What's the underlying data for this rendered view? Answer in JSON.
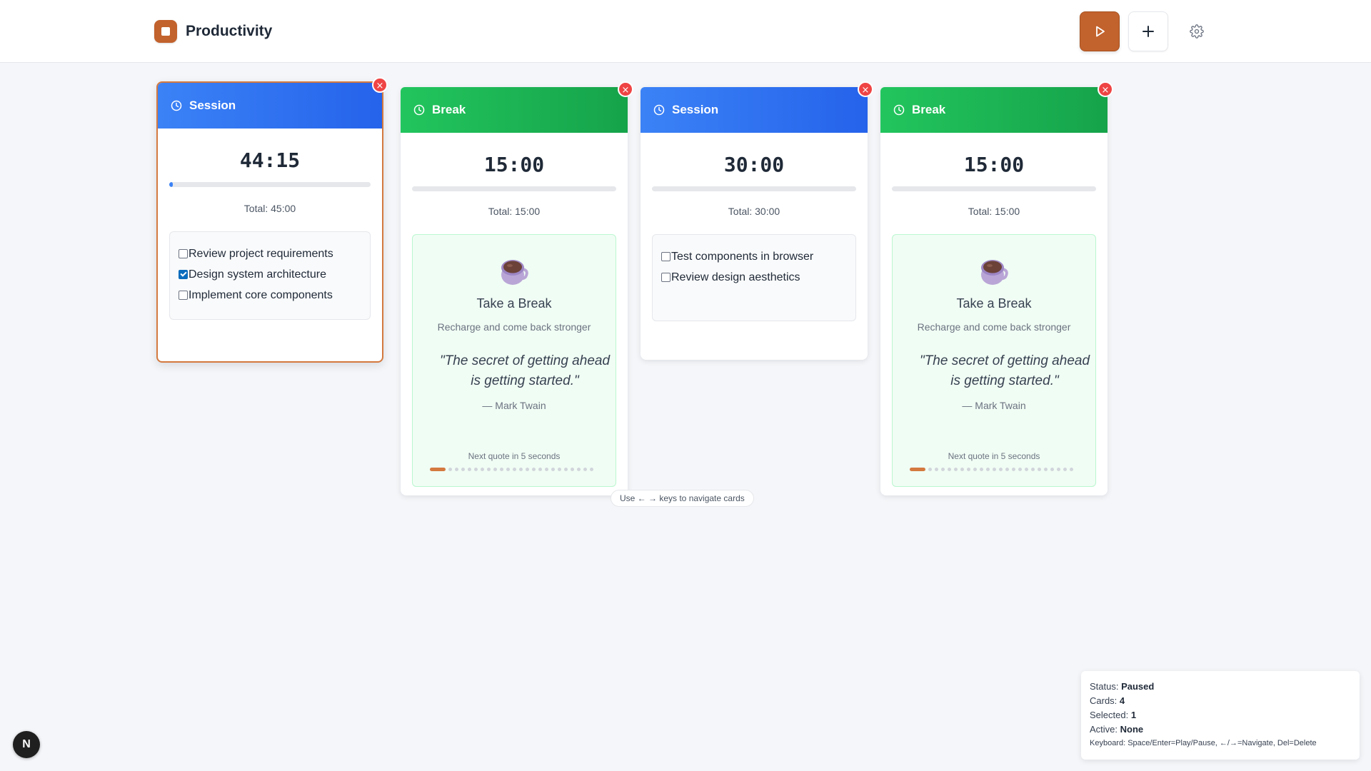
{
  "app": {
    "title": "Productivity"
  },
  "header": {
    "play_icon": "play-icon",
    "add_icon": "plus-icon",
    "settings_icon": "gear-icon",
    "accent_color": "#c2622d"
  },
  "cards": [
    {
      "type": "Session",
      "timer": "44:15",
      "total": "Total: 45:00",
      "progress": 0.02,
      "selected": true,
      "tasks": [
        {
          "label": "Review project requirements",
          "checked": false
        },
        {
          "label": "Design system architecture",
          "checked": true
        },
        {
          "label": "Implement core components",
          "checked": false
        }
      ]
    },
    {
      "type": "Break",
      "timer": "15:00",
      "total": "Total: 15:00",
      "progress": 0,
      "break_title": "Take a Break",
      "break_subtitle": "Recharge and come back stronger",
      "quote": "\"The secret of getting ahead is getting started.\"",
      "author": "— Mark Twain",
      "next_quote": "Next quote in 5 seconds"
    },
    {
      "type": "Session",
      "timer": "30:00",
      "total": "Total: 30:00",
      "progress": 0,
      "tasks": [
        {
          "label": "Test components in browser",
          "checked": false
        },
        {
          "label": "Review design aesthetics",
          "checked": false
        }
      ]
    },
    {
      "type": "Break",
      "timer": "15:00",
      "total": "Total: 15:00",
      "progress": 0,
      "break_title": "Take a Break",
      "break_subtitle": "Recharge and come back stronger",
      "quote": "\"The secret of getting ahead is getting started.\"",
      "author": "— Mark Twain",
      "next_quote": "Next quote in 5 seconds"
    }
  ],
  "close_label": "×",
  "nav_hint": "Use ← → keys to navigate cards",
  "status": {
    "status_label": "Status:",
    "status_value": "Paused",
    "cards_label": "Cards:",
    "cards_value": "4",
    "selected_label": "Selected:",
    "selected_value": "1",
    "active_label": "Active:",
    "active_value": "None",
    "keyboard": "Keyboard: Space/Enter=Play/Pause, ←/→=Navigate, Del=Delete"
  },
  "badge": {
    "letter": "N"
  }
}
